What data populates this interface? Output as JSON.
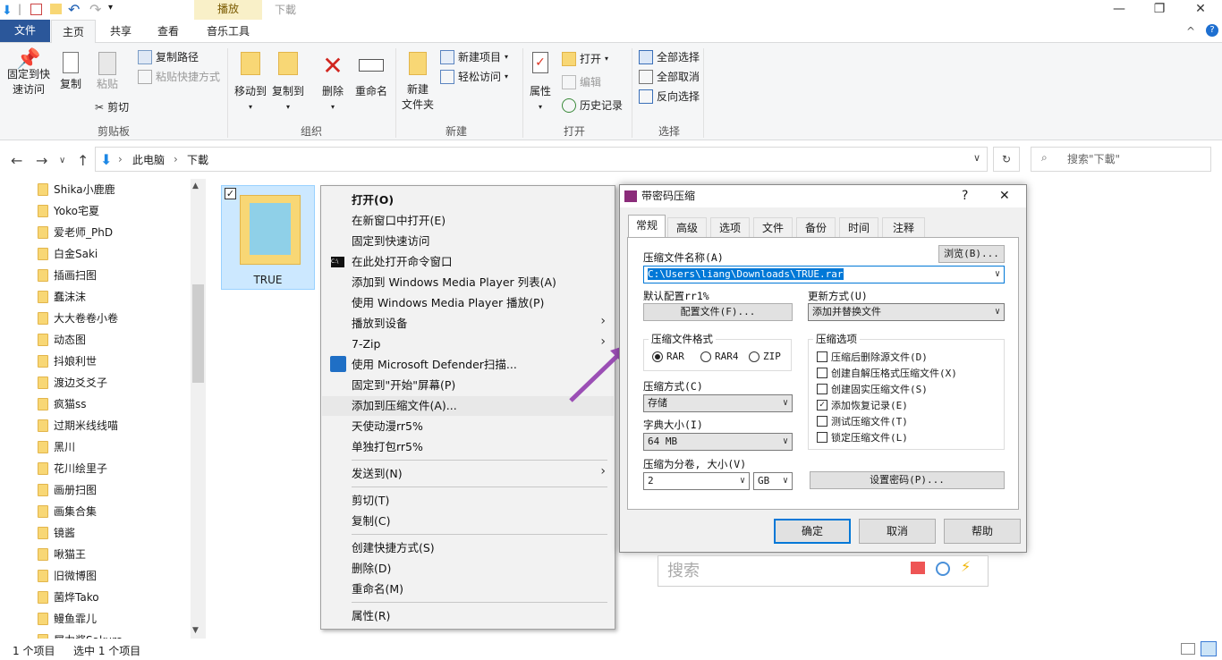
{
  "titlebar": {
    "context_group": "播放",
    "window_title": "下載",
    "controls": {
      "minimize": "—",
      "maximize": "❐",
      "close": "✕"
    }
  },
  "ribbon_tabs": {
    "file": "文件",
    "tabs": [
      "主页",
      "共享",
      "查看",
      "音乐工具"
    ],
    "active": "主页",
    "collapse": "^",
    "help": "?"
  },
  "ribbon": {
    "clipboard": {
      "pin": "固定到快\n速访问",
      "copy": "复制",
      "paste": "粘贴",
      "copy_path": "复制路径",
      "paste_shortcut": "粘贴快捷方式",
      "cut": "剪切",
      "label": "剪贴板"
    },
    "organize": {
      "move_to": "移动到",
      "copy_to": "复制到",
      "delete": "删除",
      "rename": "重命名",
      "label": "组织"
    },
    "new": {
      "new_folder": "新建\n文件夹",
      "new_item": "新建项目",
      "easy_access": "轻松访问",
      "label": "新建"
    },
    "open": {
      "properties": "属性",
      "open": "打开",
      "edit": "编辑",
      "history": "历史记录",
      "label": "打开"
    },
    "select": {
      "select_all": "全部选择",
      "select_none": "全部取消",
      "invert": "反向选择",
      "label": "选择"
    }
  },
  "address": {
    "crumbs": [
      "此电脑",
      "下載"
    ],
    "search_placeholder": "搜索\"下載\""
  },
  "tree": {
    "items": [
      "Shika小鹿鹿",
      "Yoko宅夏",
      "爱老师_PhD",
      "白金Saki",
      "插画扫图",
      "蠢沫沫",
      "大大卷卷小卷",
      "动态图",
      "抖娘利世",
      "渡边爻爻子",
      "疯猫ss",
      "过期米线线喵",
      "黑川",
      "花川绘里子",
      "画册扫图",
      "画集合集",
      "镜酱",
      "啾猫王",
      "旧微博图",
      "菌烨Tako",
      "鳗鱼霏儿",
      "犀力酱Sakura"
    ]
  },
  "file": {
    "name": "TRUE"
  },
  "status": {
    "count": "1 个项目",
    "selected": "选中 1 个项目"
  },
  "context_menu": {
    "items": [
      {
        "label": "打开(O)"
      },
      {
        "label": "在新窗口中打开(E)"
      },
      {
        "label": "固定到快速访问"
      },
      {
        "label": "在此处打开命令窗口"
      },
      {
        "label": "添加到 Windows Media Player 列表(A)"
      },
      {
        "label": "使用 Windows Media Player 播放(P)"
      },
      {
        "label": "播放到设备"
      },
      {
        "label": "7-Zip"
      },
      {
        "label": "使用 Microsoft Defender扫描..."
      },
      {
        "label": "固定到\"开始\"屏幕(P)"
      },
      {
        "label": "添加到压缩文件(A)..."
      },
      {
        "label": "天使动漫rr5%"
      },
      {
        "label": "单独打包rr5%"
      },
      {
        "label": "发送到(N)"
      },
      {
        "label": "剪切(T)"
      },
      {
        "label": "复制(C)"
      },
      {
        "label": "创建快捷方式(S)"
      },
      {
        "label": "删除(D)"
      },
      {
        "label": "重命名(M)"
      },
      {
        "label": "属性(R)"
      }
    ]
  },
  "dialog": {
    "title": "带密码压缩",
    "help": "?",
    "close": "✕",
    "tabs": [
      "常规",
      "高级",
      "选项",
      "文件",
      "备份",
      "时间",
      "注释"
    ],
    "archive_name_label": "压缩文件名称(A)",
    "browse": "浏览(B)...",
    "archive_name_value": "C:\\Users\\liang\\Downloads\\TRUE.rar",
    "profile_label": "默认配置rr1%",
    "profile_button": "配置文件(F)...",
    "update_label": "更新方式(U)",
    "update_value": "添加并替换文件",
    "format_label": "压缩文件格式",
    "formats": [
      "RAR",
      "RAR4",
      "ZIP"
    ],
    "method_label": "压缩方式(C)",
    "method_value": "存储",
    "dict_label": "字典大小(I)",
    "dict_value": "64 MB",
    "split_label": "压缩为分卷, 大小(V)",
    "split_value": "2",
    "split_unit": "GB",
    "options_label": "压缩选项",
    "options": [
      {
        "label": "压缩后删除源文件(D)",
        "checked": false
      },
      {
        "label": "创建自解压格式压缩文件(X)",
        "checked": false
      },
      {
        "label": "创建固实压缩文件(S)",
        "checked": false
      },
      {
        "label": "添加恢复记录(E)",
        "checked": true
      },
      {
        "label": "测试压缩文件(T)",
        "checked": false
      },
      {
        "label": "锁定压缩文件(L)",
        "checked": false
      }
    ],
    "password_button": "设置密码(P)...",
    "ok": "确定",
    "cancel": "取消",
    "helpbtn": "帮助"
  },
  "bottom_search": {
    "placeholder": "搜索"
  },
  "colors": {
    "accent": "#2b579a",
    "selection": "#cce8ff",
    "arrow": "#9b4fb5"
  }
}
